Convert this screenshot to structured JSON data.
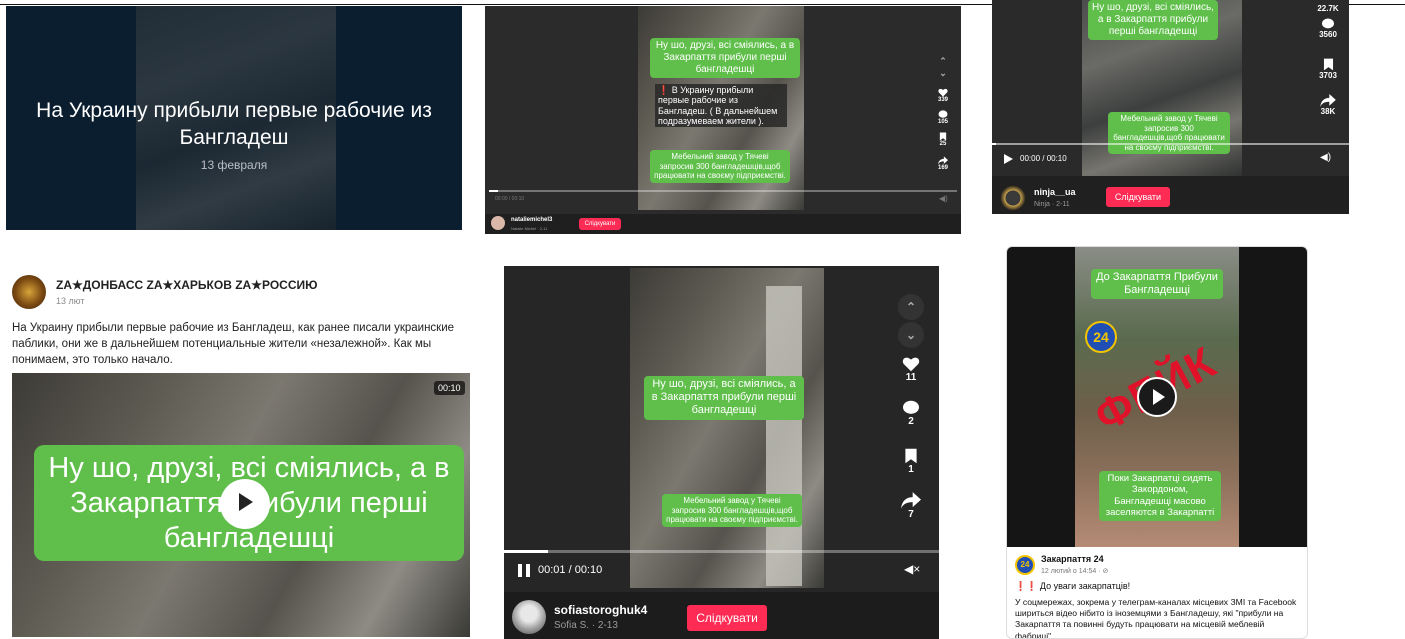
{
  "p1": {
    "title": "На Украину прибыли первые рабочие из Бангладеш",
    "date": "13 февраля"
  },
  "p2": {
    "green_top": "Ну шо, друзі, всі сміялись, а в Закарпаття прибули перші бангладешці",
    "red_text": "❗ В Украину прибыли первые рабочие из Бангладеш. ( В дальнейшем подразумеваем жители ).",
    "green_bottom": "Мебельний завод у Тячеві запросив 300 бангладешців,щоб працювати на своєму підприємстві.",
    "likes": "339",
    "comments": "105",
    "saves": "25",
    "shares": "169",
    "time": "00:00 / 00:10",
    "username": "nataliemichel3",
    "subline": "Natalie Michel · 2-11",
    "follow": "Слідкувати"
  },
  "p3": {
    "green_top": "Ну шо, друзі, всі сміялись, а в Закарпаття прибули перші бангладешці",
    "green_bottom": "Мебельний завод у Тячеві запросив 300 бангладешців,щоб працювати на своєму підприємстві.",
    "likes": "22.7K",
    "comments": "3560",
    "saves": "3703",
    "shares": "38K",
    "time": "00:00 / 00:10",
    "username": "ninja__ua",
    "subline": "Ninja · 2-11",
    "follow": "Слідкувати"
  },
  "p4": {
    "page_name": "ZA★ДОНБАСС ZA★ХАРЬКОВ ZA★РОССИЮ",
    "post_time": "13 лют",
    "post_text": "На Украину прибыли первые рабочие из Бангладеш, как ранее писали украинские паблики, они же в дальнейшем потенциальные жители «незалежной». Как мы понимаем, это только начало.",
    "duration": "00:10",
    "green_caption": "Ну шо, друзі, всі сміялись, а в Закарпаття прибули перші бангладешці"
  },
  "p5": {
    "green_top": "Ну шо, друзі, всі сміялись, а в Закарпаття прибули перші бангладешці",
    "green_bottom": "Мебельний завод у Тячеві запросив 300 бангладешців,щоб працювати на своєму підприємстві.",
    "likes": "11",
    "comments": "2",
    "saves": "1",
    "shares": "7",
    "progress": 0.1,
    "time": "00:01 / 00:10",
    "username": "sofiastoroghuk4",
    "subline": "Sofia S. · 2-13",
    "follow": "Слідкувати"
  },
  "p6": {
    "green_top": "До Закарпаття Прибули Бангладешці",
    "logo_text": "24",
    "fake_stamp": "ФЕЙК",
    "green_bottom": "Поки Закарпатці сидять Закордоном, Бангладешці масово заселяются в Закарпатті",
    "page_name": "Закарпаття 24",
    "post_time": "12 лютий о 14:54 · ⊘",
    "alert": "❗❗ До уваги закарпатців!",
    "post_text": "У соцмережах, зокрема у телеграм-каналах місцевих ЗМІ та Facebook шириться відео нібито із іноземцями з Бангладешу, які \"прибули на Закарпаття та повинні будуть працювати на місцевій меблевій фабриці\"."
  },
  "colors": {
    "green": "#5fbf4a",
    "tiktok_red": "#fe2c55",
    "fake_red": "#e0122a"
  }
}
